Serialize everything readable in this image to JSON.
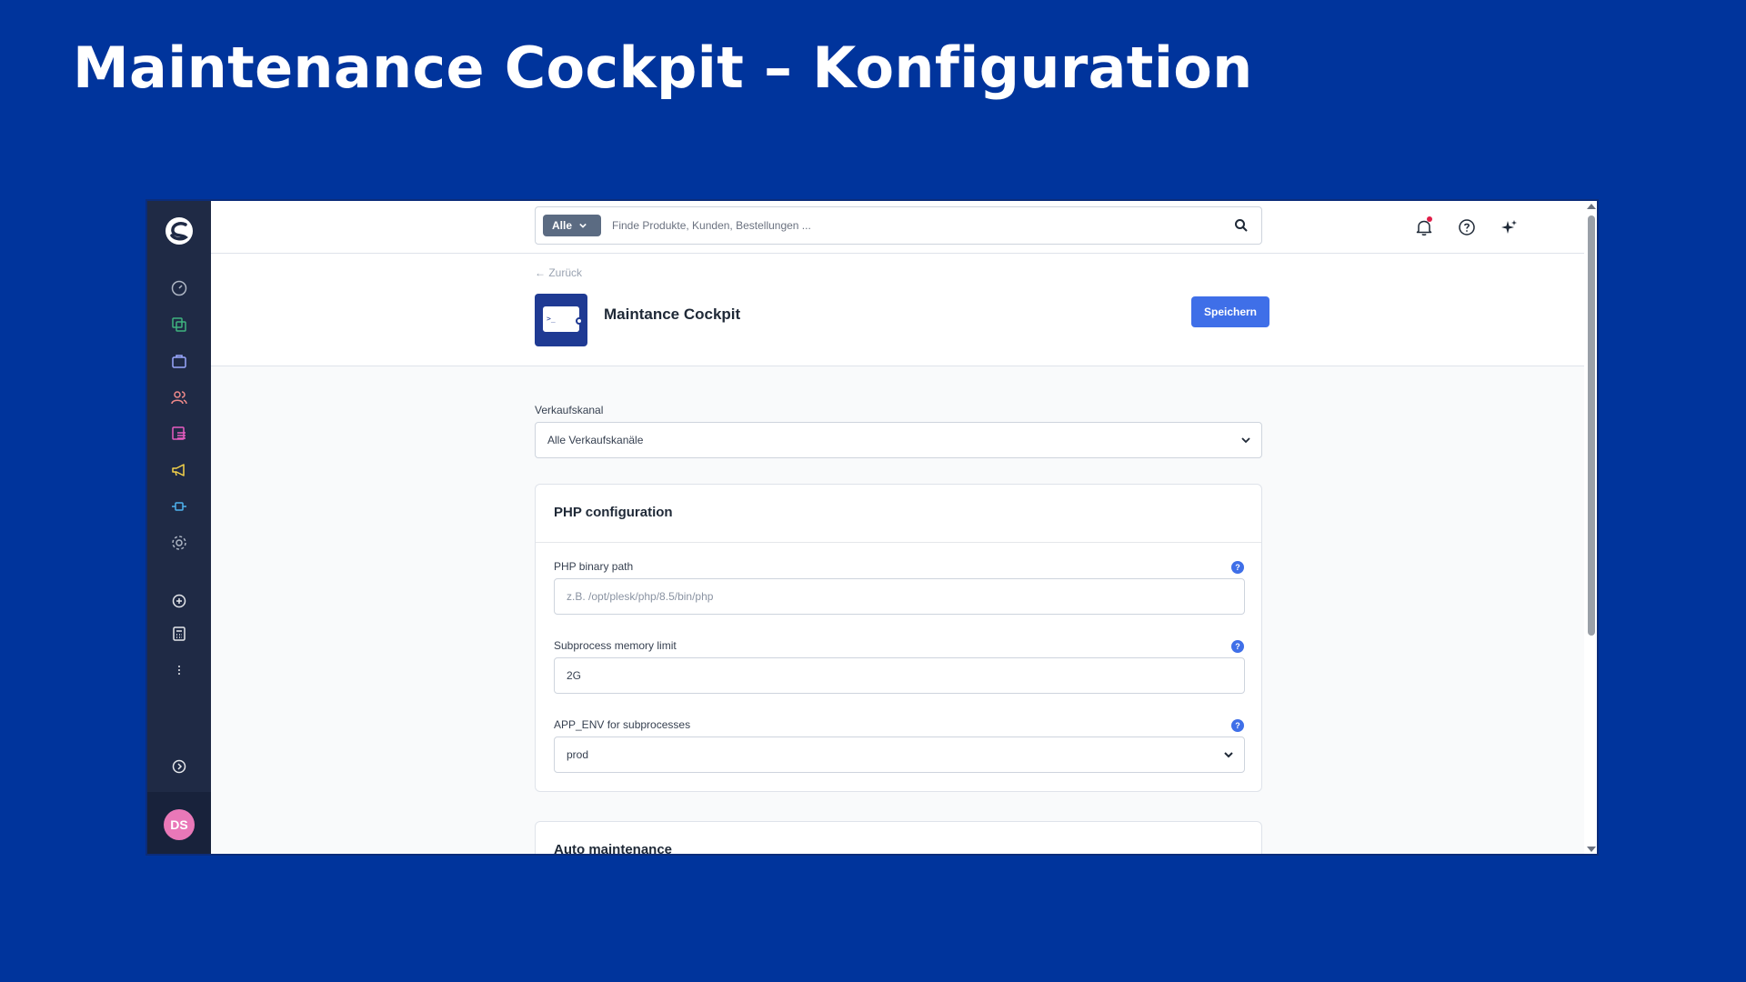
{
  "slide": {
    "title": "Maintenance Cockpit – Konfiguration"
  },
  "topbar": {
    "search_scope": "Alle",
    "search_placeholder": "Finde Produkte, Kunden, Bestellungen ..."
  },
  "sidebar": {
    "icons": [
      "dashboard-icon",
      "catalogue-icon",
      "orders-icon",
      "customers-icon",
      "content-icon",
      "marketing-icon",
      "extensions-icon",
      "settings-icon",
      "add-icon",
      "calculator-icon",
      "more-icon",
      "expand-icon"
    ],
    "user_initials": "DS"
  },
  "header": {
    "back_label": "← Zurück",
    "app_name": "Maintance Cockpit",
    "app_icon_prompt": ">_",
    "save_label": "Speichern"
  },
  "sales_channel": {
    "label": "Verkaufskanal",
    "value": "Alle Verkaufskanäle"
  },
  "php_config": {
    "title": "PHP configuration",
    "fields": [
      {
        "label": "PHP binary path",
        "placeholder": "z.B. /opt/plesk/php/8.5/bin/php",
        "value": ""
      },
      {
        "label": "Subprocess memory limit",
        "value": "2G"
      },
      {
        "label": "APP_ENV for subprocesses",
        "value": "prod"
      }
    ]
  },
  "auto_maintenance": {
    "title": "Auto maintenance"
  },
  "colors": {
    "slide_bg": "#00349c",
    "sidebar_bg": "#1f2a45",
    "primary": "#3f6fe8",
    "avatar": "#e978b8"
  }
}
